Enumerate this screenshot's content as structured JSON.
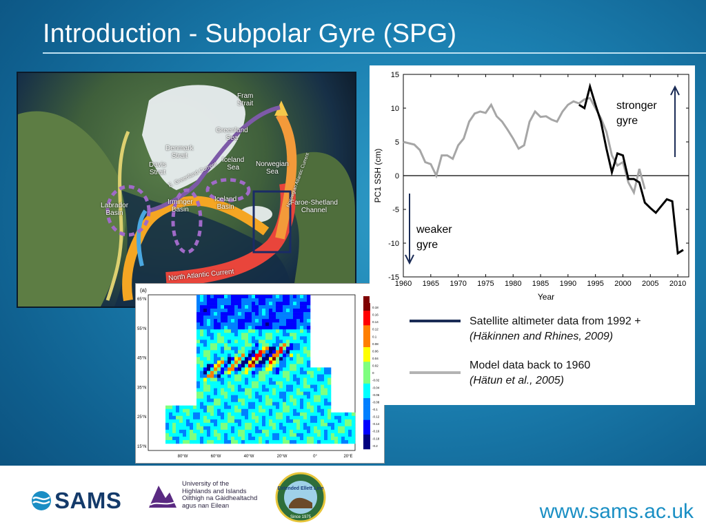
{
  "slide": {
    "title": "Introduction - Subpolar Gyre (SPG)",
    "url": "www.sams.ac.uk"
  },
  "map": {
    "labels": {
      "fram": "Fram\nStrait",
      "greenland_sea": "Greenland\nSea",
      "denmark": "Denmark\nStrait",
      "davis": "Davis\nStrait",
      "iceland_sea": "Iceland\nSea",
      "norwegian_sea": "Norwegian\nSea",
      "labrador": "Labrador\nBasin",
      "irminger": "Irminger\nBasin",
      "iceland_basin": "Iceland\nBasin",
      "faroe": "Faroe-Shetland\nChannel",
      "nac": "North Atlantic Current",
      "egc": "E. Greenland Current",
      "nwac": "Norwegian Atlantic Current"
    }
  },
  "heatmap": {
    "panel_label": "(a)",
    "lat_labels": [
      "65°N",
      "55°N",
      "45°N",
      "35°N",
      "25°N",
      "15°N"
    ],
    "lon_labels": [
      "80°W",
      "60°W",
      "40°W",
      "20°W",
      "0°",
      "20°E"
    ],
    "colorbar_ticks": [
      "0.2",
      "0.18",
      "0.16",
      "0.14",
      "0.12",
      "0.1",
      "0.08",
      "0.06",
      "0.04",
      "0.02",
      "0",
      "-0.02",
      "-0.04",
      "-0.06",
      "-0.08",
      "-0.1",
      "-0.12",
      "-0.14",
      "-0.16",
      "-0.18",
      "-0.2"
    ]
  },
  "chart_data": {
    "type": "line",
    "xlabel": "Year",
    "ylabel": "PC1 SSH (cm)",
    "xlim": [
      1960,
      2012
    ],
    "ylim": [
      -15,
      15
    ],
    "xticks": [
      1960,
      1965,
      1970,
      1975,
      1980,
      1985,
      1990,
      1995,
      2000,
      2005,
      2010
    ],
    "yticks": [
      15,
      10,
      5,
      0,
      -5,
      -10,
      -15
    ],
    "series": [
      {
        "name": "Model data back to 1960",
        "color": "#a6a6a6",
        "x": [
          1960,
          1962,
          1963,
          1964,
          1965,
          1966,
          1967,
          1968,
          1969,
          1970,
          1971,
          1972,
          1973,
          1974,
          1975,
          1976,
          1977,
          1978,
          1979,
          1980,
          1981,
          1982,
          1983,
          1984,
          1985,
          1986,
          1987,
          1988,
          1989,
          1990,
          1991,
          1992,
          1993,
          1994,
          1995,
          1996,
          1997,
          1998,
          1999,
          2000,
          2001,
          2002,
          2003,
          2004
        ],
        "y": [
          5.0,
          4.6,
          3.8,
          2.0,
          1.7,
          0.0,
          3.0,
          3.0,
          2.5,
          4.5,
          5.5,
          8.0,
          9.2,
          9.5,
          9.3,
          10.5,
          8.8,
          8.0,
          6.8,
          5.5,
          4.0,
          4.5,
          8.0,
          9.5,
          8.7,
          8.8,
          8.3,
          8.0,
          9.5,
          10.5,
          11.0,
          10.7,
          11.3,
          11.5,
          10.0,
          8.5,
          6.5,
          3.0,
          1.5,
          2.0,
          -1.0,
          -2.5,
          1.0,
          -2.0
        ]
      },
      {
        "name": "Satellite altimeter data from 1992 +",
        "color": "#000000",
        "x": [
          1992,
          1993,
          1994,
          1995,
          1996,
          1997,
          1998,
          1999,
          2000,
          2001,
          2002,
          2003,
          2004,
          2005,
          2006,
          2007,
          2008,
          2009,
          2010,
          2011
        ],
        "y": [
          10.5,
          10.0,
          13.2,
          10.5,
          8.0,
          4.0,
          0.5,
          3.3,
          3.0,
          -0.5,
          -0.5,
          -1.0,
          -4.0,
          -4.8,
          -5.5,
          -4.5,
          -3.5,
          -3.8,
          -11.5,
          -11.0
        ]
      }
    ],
    "annotations": {
      "stronger": "stronger\ngyre",
      "weaker": "weaker\ngyre"
    }
  },
  "legend": {
    "sat_line1": "Satellite altimeter data from 1992 +",
    "sat_line2": "(Häkinnen and Rhines, 2009)",
    "model_line1": "Model data back to 1960",
    "model_line2": "(Hätun et al., 2005)",
    "sat_color": "#1a2b55",
    "model_color": "#b3b3b3"
  },
  "logos": {
    "sams": "SAMS",
    "uhi_line1": "University of the",
    "uhi_line2": "Highlands and Islands",
    "uhi_line3": "Oilthigh na Gàidhealtachd",
    "uhi_line4": "agus nan Eilean",
    "ellett": "Extended\nEllett Line",
    "ellett_since": "Since 1975"
  }
}
